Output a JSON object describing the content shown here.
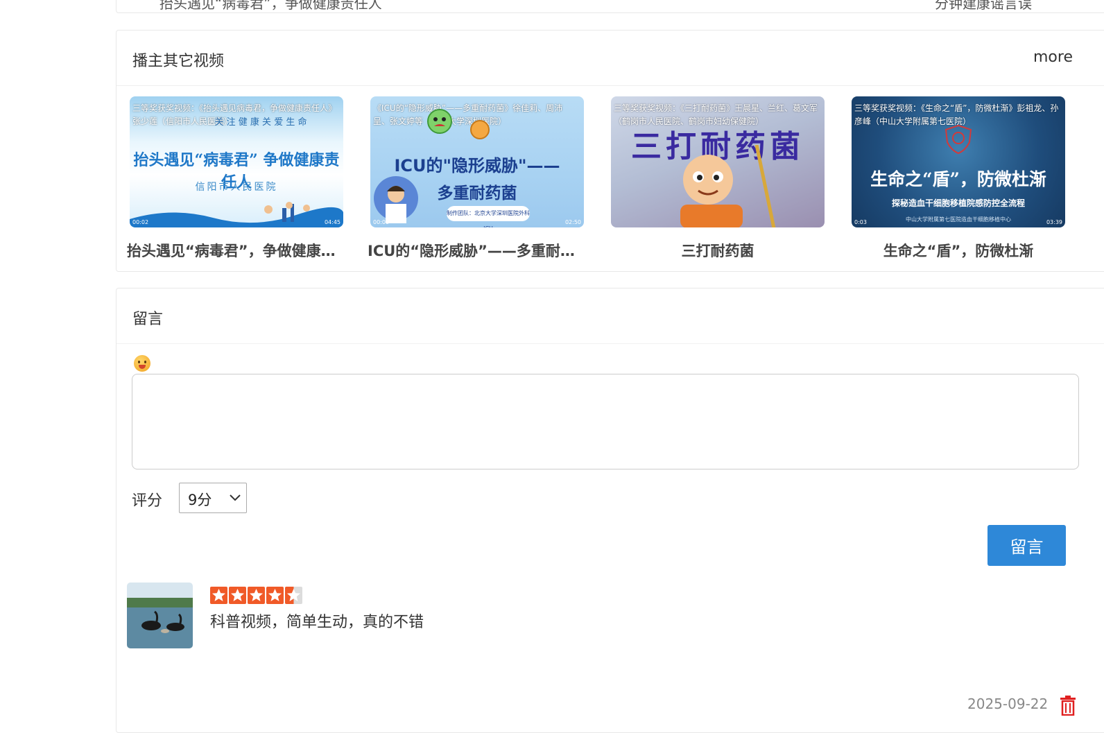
{
  "top_card": {
    "left_text": "抬头遇见“病毒君”，争做健康责任人",
    "right_text": "分钟建康谣言误"
  },
  "videos": {
    "title": "播主其它视频",
    "more_label": "more",
    "items": [
      {
        "overlay": "三等奖获奖视频：《抬头遇见病毒君，争做健康责任人》张少莲（信阳市人民医院）",
        "thumb_slogan": "关 注 健 康   关 爱 生 命",
        "thumb_headline": "抬头遇见“病毒君” 争做健康责任人",
        "thumb_sub": "信阳市人民医院",
        "time_start": "00:02",
        "time_end": "04:45",
        "title": "抬头遇见“病毒君”，争做健康责任人"
      },
      {
        "overlay": "《ICU的“隐形威胁”——多重耐药菌》徐佳莉、周沛呈、张文婷等（北京大学深圳医院）",
        "thumb_headline": "ICU的\"隐形威胁\"——",
        "thumb_headline2": "多重耐药菌",
        "thumb_sub": "制作团队：北京大学深圳医院外科ICU",
        "time_start": "00:00",
        "time_end": "02:50",
        "title": "ICU的“隐形威胁”——多重耐药菌"
      },
      {
        "overlay": "三等奖获奖视频：《三打耐药菌》王晨星、兰红、葛文军（鹤岗市人民医院、鹤岗市妇幼保健院）",
        "thumb_headline": "三打耐药菌",
        "time_start": "",
        "time_end": "",
        "title": "三打耐药菌"
      },
      {
        "overlay": "三等奖获奖视频：《生命之“盾”，防微杜渐》彭祖龙、孙彦峰（中山大学附属第七医院）",
        "thumb_headline": "生命之“盾”，防微杜渐",
        "thumb_sub": "探秘造血干细胞移植院感防控全流程",
        "thumb_sub2": "中山大学附属第七医院造血干细胞移植中心",
        "time_start": "0:03",
        "time_end": "03:39",
        "title": "生命之“盾”，防微杜渐"
      }
    ]
  },
  "comments": {
    "title": "留言",
    "textarea_value": "",
    "rating_label": "评分",
    "rating_selected": "9分",
    "submit_label": "留言",
    "list": [
      {
        "rating": 4.5,
        "text": "科普视频，简单生动，真的不错",
        "date": "2025-09-22"
      }
    ]
  },
  "colors": {
    "accent": "#2e88d8",
    "star": "#f05a28"
  }
}
